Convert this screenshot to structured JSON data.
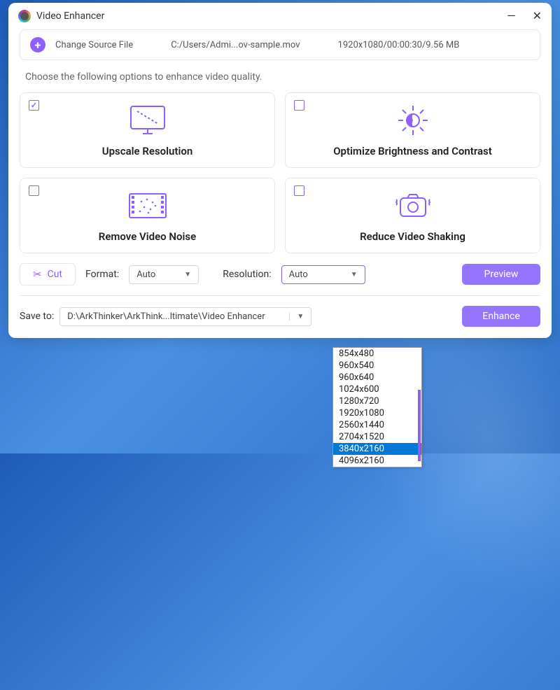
{
  "window": {
    "title": "Video Enhancer"
  },
  "source": {
    "change_label": "Change Source File",
    "path": "C:/Users/Admi...ov-sample.mov",
    "meta": "1920x1080/00:00:30/9.56 MB"
  },
  "instruction": "Choose the following options to enhance video quality.",
  "options": {
    "upscale": {
      "title": "Upscale Resolution",
      "checked": true
    },
    "brightness": {
      "title": "Optimize Brightness and Contrast",
      "checked": false
    },
    "denoise": {
      "title": "Remove Video Noise",
      "checked": false
    },
    "stabilize": {
      "title": "Reduce Video Shaking",
      "checked": false
    }
  },
  "controls": {
    "cut_label": "Cut",
    "format_label": "Format:",
    "format_value": "Auto",
    "resolution_label": "Resolution:",
    "resolution_value": "Auto",
    "preview_label": "Preview"
  },
  "dropdown": {
    "items": [
      "854x480",
      "960x540",
      "960x640",
      "1024x600",
      "1280x720",
      "1920x1080",
      "2560x1440",
      "2704x1520",
      "3840x2160",
      "4096x2160"
    ],
    "selected": "3840x2160"
  },
  "save": {
    "label": "Save to:",
    "path": "D:\\ArkThinker\\ArkThink...ltimate\\Video Enhancer",
    "enhance_label": "Enhance"
  }
}
